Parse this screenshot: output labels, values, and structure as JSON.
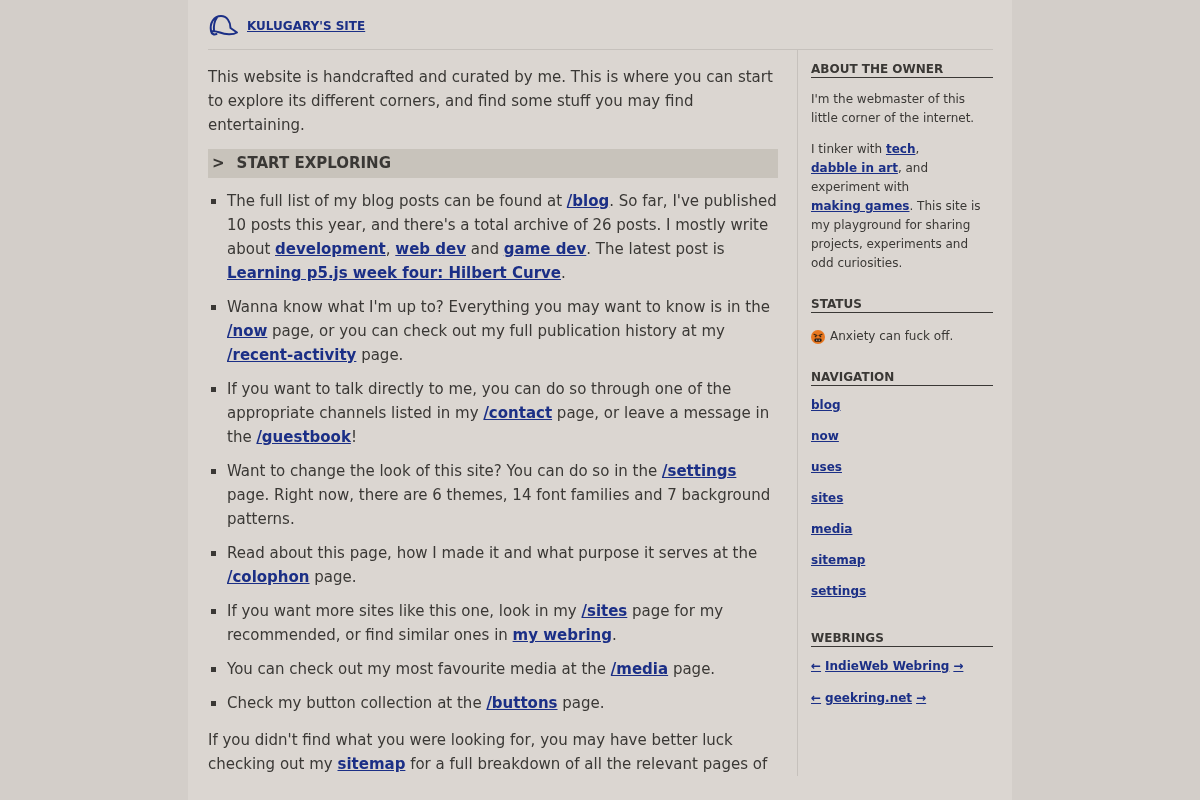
{
  "header": {
    "title": "KULUGARY'S SITE"
  },
  "intro": "This website is handcrafted and curated by me. This is where you can start to explore its different corners, and find some stuff you may find entertaining.",
  "section": {
    "marker": ">",
    "title": "START EXPLORING"
  },
  "items": [
    [
      {
        "kind": "text",
        "text": "The full list of my blog posts can be found at "
      },
      {
        "kind": "link",
        "text": "/blog"
      },
      {
        "kind": "text",
        "text": ". So far, I've published 10 posts this year, and there's a total archive of 26 posts. I mostly write about "
      },
      {
        "kind": "link",
        "text": "development"
      },
      {
        "kind": "text",
        "text": ", "
      },
      {
        "kind": "link",
        "text": "web dev"
      },
      {
        "kind": "text",
        "text": " and "
      },
      {
        "kind": "link",
        "text": "game dev"
      },
      {
        "kind": "text",
        "text": ". The latest post is "
      },
      {
        "kind": "link",
        "text": "Learning p5.js week four: Hilbert Curve"
      },
      {
        "kind": "text",
        "text": "."
      }
    ],
    [
      {
        "kind": "text",
        "text": "Wanna know what I'm up to? Everything you may want to know is in the "
      },
      {
        "kind": "link",
        "text": "/now"
      },
      {
        "kind": "text",
        "text": " page, or you can check out my full publication history at my "
      },
      {
        "kind": "link",
        "text": "/recent-activity"
      },
      {
        "kind": "text",
        "text": " page."
      }
    ],
    [
      {
        "kind": "text",
        "text": "If you want to talk directly to me, you can do so through one of the appropriate channels listed in my "
      },
      {
        "kind": "link",
        "text": "/contact"
      },
      {
        "kind": "text",
        "text": " page, or leave a message in the "
      },
      {
        "kind": "link",
        "text": "/guestbook"
      },
      {
        "kind": "text",
        "text": "!"
      }
    ],
    [
      {
        "kind": "text",
        "text": "Want to change the look of this site? You can do so in the "
      },
      {
        "kind": "link",
        "text": "/settings"
      },
      {
        "kind": "text",
        "text": " page. Right now, there are 6 themes, 14 font families and 7 background patterns."
      }
    ],
    [
      {
        "kind": "text",
        "text": "Read about this page, how I made it and what purpose it serves at the "
      },
      {
        "kind": "link",
        "text": "/colophon"
      },
      {
        "kind": "text",
        "text": " page."
      }
    ],
    [
      {
        "kind": "text",
        "text": "If you want more sites like this one, look in my "
      },
      {
        "kind": "link",
        "text": "/sites"
      },
      {
        "kind": "text",
        "text": " page for my recommended, or find similar ones in "
      },
      {
        "kind": "link",
        "text": "my webring"
      },
      {
        "kind": "text",
        "text": "."
      }
    ],
    [
      {
        "kind": "text",
        "text": "You can check out my most favourite media at the "
      },
      {
        "kind": "link",
        "text": "/media"
      },
      {
        "kind": "text",
        "text": " page."
      }
    ],
    [
      {
        "kind": "text",
        "text": "Check my button collection at the "
      },
      {
        "kind": "link",
        "text": "/buttons"
      },
      {
        "kind": "text",
        "text": " page."
      }
    ]
  ],
  "outro": [
    {
      "kind": "text",
      "text": "If you didn't find what you were looking for, you may have better luck checking out my "
    },
    {
      "kind": "link",
      "text": "sitemap"
    },
    {
      "kind": "text",
      "text": " for a full breakdown of all the relevant pages of"
    }
  ],
  "sidebar": [
    {
      "kind": "paragraphs",
      "title": "ABOUT THE OWNER",
      "paragraphs": [
        [
          {
            "kind": "text",
            "text": "I'm the webmaster of this little corner of the internet."
          }
        ],
        [
          {
            "kind": "text",
            "text": "I tinker with "
          },
          {
            "kind": "link",
            "text": "tech"
          },
          {
            "kind": "text",
            "text": ", "
          },
          {
            "kind": "link",
            "text": "dabble in art"
          },
          {
            "kind": "text",
            "text": ", and experiment with "
          },
          {
            "kind": "link",
            "text": "making games"
          },
          {
            "kind": "text",
            "text": ". This site is my playground for sharing projects, experiments and odd curiosities."
          }
        ]
      ]
    },
    {
      "kind": "status",
      "title": "STATUS",
      "text": "Anxiety can fuck off."
    },
    {
      "kind": "links",
      "title": "NAVIGATION",
      "links": [
        "blog",
        "now",
        "uses",
        "sites",
        "media",
        "sitemap",
        "settings"
      ]
    },
    {
      "kind": "webrings",
      "title": "WEBRINGS",
      "rings": [
        {
          "prev": "←",
          "name": "IndieWeb Webring",
          "next": "→"
        },
        {
          "prev": "←",
          "name": "geekring.net",
          "next": "→"
        }
      ]
    }
  ]
}
